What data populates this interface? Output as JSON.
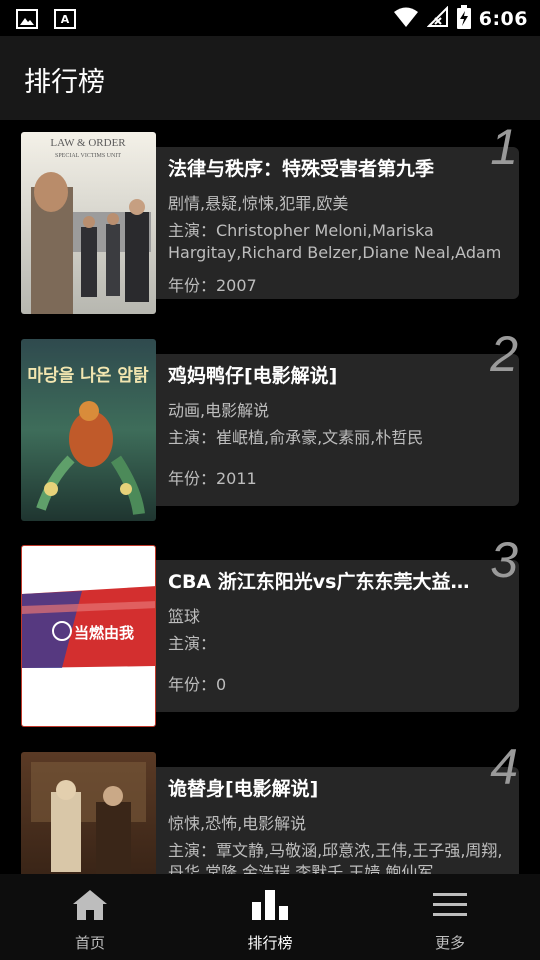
{
  "status_bar": {
    "time": "6:06"
  },
  "header": {
    "title": "排行榜"
  },
  "items": [
    {
      "rank": "1",
      "title": "法律与秩序：特殊受害者第九季",
      "genres": "剧情,悬疑,惊悚,犯罪,欧美",
      "actors": "主演：Christopher Meloni,Mariska Hargitay,Richard Belzer,Diane Neal,Adam ...",
      "year": "年份：2007",
      "poster": {
        "caption_line1": "LAW & ORDER",
        "caption_line2": "SPECIAL VICTIMS UNIT"
      }
    },
    {
      "rank": "2",
      "title": "鸡妈鸭仔[电影解说]",
      "genres": "动画,电影解说",
      "actors": "主演：崔岷植,俞承豪,文素丽,朴哲民",
      "year": "年份：2011",
      "poster": {
        "caption_line1": "마당을 나온 암탉"
      }
    },
    {
      "rank": "3",
      "title": "CBA 浙江东阳光vs广东东莞大益…",
      "genres": "篮球",
      "actors": "主演：",
      "year": "年份：0",
      "poster": {
        "caption_line1": "当燃由我"
      }
    },
    {
      "rank": "4",
      "title": "诡替身[电影解说]",
      "genres": "惊悚,恐怖,电影解说",
      "actors": "主演：覃文静,马敬涵,邱意浓,王伟,王子强,周翔,丹华,常隆,金浩瑞,李默千,王嫱,鲍仙军",
      "year": "",
      "poster": {}
    }
  ],
  "bottom_nav": [
    {
      "label": "首页",
      "icon": "home-icon",
      "active": false
    },
    {
      "label": "排行榜",
      "icon": "chart-icon",
      "active": true
    },
    {
      "label": "更多",
      "icon": "menu-icon",
      "active": false
    }
  ]
}
